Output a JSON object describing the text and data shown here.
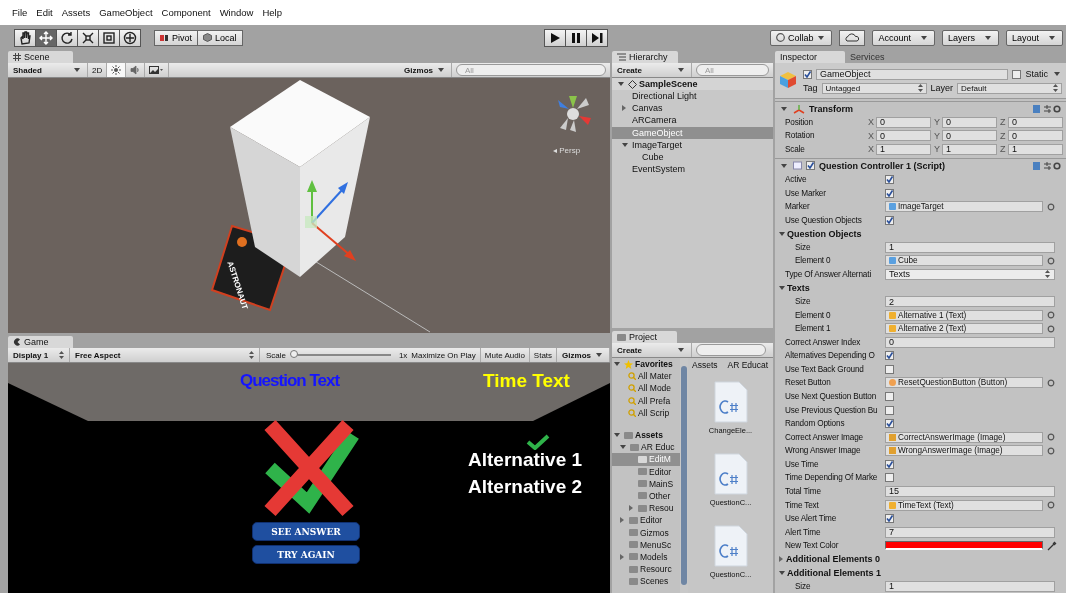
{
  "menu": [
    "File",
    "Edit",
    "Assets",
    "GameObject",
    "Component",
    "Window",
    "Help"
  ],
  "toolbar": {
    "tools": [
      {
        "kind": "hand",
        "selected": false
      },
      {
        "kind": "move",
        "selected": true
      },
      {
        "kind": "rotate",
        "selected": false
      },
      {
        "kind": "scale",
        "selected": false
      },
      {
        "kind": "rect",
        "selected": false
      },
      {
        "kind": "transform",
        "selected": false
      }
    ],
    "pivot": "Pivot",
    "local": "Local",
    "right": [
      {
        "kind": "collab",
        "label": "Collab"
      },
      {
        "kind": "cloud"
      },
      {
        "kind": "dropdown",
        "label": "Account"
      },
      {
        "kind": "dropdown",
        "label": "Layers"
      },
      {
        "kind": "dropdown",
        "label": "Layout"
      }
    ]
  },
  "scene": {
    "tab": "Scene",
    "shading": "Shaded",
    "mode_2d": "2D",
    "toggles": [
      {
        "kind": "lighting",
        "on": true
      },
      {
        "kind": "audio",
        "on": false
      },
      {
        "kind": "effects",
        "on": false
      }
    ],
    "gizmos": "Gizmos",
    "search_placeholder": "All",
    "marker_text": "ASTRONAUT",
    "view_label": "◂ Persp"
  },
  "game": {
    "tab": "Game",
    "display": "Display 1",
    "aspect": "Free Aspect",
    "scale": {
      "label": "Scale",
      "level": 0,
      "value": "1x"
    },
    "options": [
      "Maximize On Play",
      "Mute Audio",
      "Stats"
    ],
    "gizmos": "Gizmos",
    "question_text": "Question Text",
    "time_text": "Time Text",
    "alternatives": [
      {
        "label": "Alternative 1",
        "correct": true
      },
      {
        "label": "Alternative 2",
        "correct": false
      }
    ],
    "buttons": [
      "SEE ANSWER",
      "TRY AGAIN"
    ]
  },
  "hierarchy": {
    "tab": "Hierarchy",
    "create": "Create",
    "search_placeholder": "All",
    "scene": "SampleScene",
    "items": [
      {
        "label": "Directional Light",
        "selected": false
      },
      {
        "label": "Canvas",
        "selected": false,
        "expanded": false
      },
      {
        "label": "ARCamera",
        "selected": false
      },
      {
        "label": "GameObject",
        "selected": true
      },
      {
        "label": "ImageTarget",
        "selected": false,
        "expanded": true,
        "children": [
          {
            "label": "Cube",
            "selected": false
          }
        ]
      },
      {
        "label": "EventSystem",
        "selected": false
      }
    ]
  },
  "project": {
    "tab": "Project",
    "create": "Create",
    "favorites": {
      "label": "Favorites",
      "expanded": true,
      "items": [
        "All Mater",
        "All Mode",
        "All Prefa",
        "All Scrip"
      ]
    },
    "assets": {
      "label": "Assets",
      "expanded": true,
      "children": [
        {
          "label": "AR Educ",
          "selected": false,
          "expanded": true,
          "children": [
            {
              "label": "EditM",
              "selected": true
            },
            {
              "label": "Editor",
              "selected": false
            },
            {
              "label": "MainS",
              "selected": false
            },
            {
              "label": "Other",
              "selected": false
            },
            {
              "label": "Resou",
              "selected": false,
              "expanded": false
            }
          ]
        },
        {
          "label": "Editor",
          "selected": false,
          "expanded": false
        },
        {
          "label": "Gizmos",
          "selected": false
        },
        {
          "label": "MenuSc",
          "selected": false
        },
        {
          "label": "Models",
          "selected": false,
          "expanded": false
        },
        {
          "label": "Resourc",
          "selected": false
        },
        {
          "label": "Scenes",
          "selected": false
        }
      ]
    },
    "breadcrumb": [
      "Assets",
      "AR Educat"
    ],
    "files": [
      "ChangeEle...",
      "QuestionC...",
      "QuestionC..."
    ]
  },
  "inspector": {
    "tabs": [
      {
        "label": "Inspector",
        "selected": true
      },
      {
        "label": "Services",
        "selected": false
      }
    ],
    "object": {
      "active": true,
      "name": "GameObject",
      "static_label": "Static",
      "static": false,
      "tag_label": "Tag",
      "tag": "Untagged",
      "layer_label": "Layer",
      "layer": "Default"
    },
    "transform": {
      "title": "Transform",
      "expanded": true,
      "rows": [
        {
          "label": "Position",
          "values": [
            {
              "axis": "X",
              "value": "0"
            },
            {
              "axis": "Y",
              "value": "0"
            },
            {
              "axis": "Z",
              "value": "0"
            }
          ]
        },
        {
          "label": "Rotation",
          "values": [
            {
              "axis": "X",
              "value": "0"
            },
            {
              "axis": "Y",
              "value": "0"
            },
            {
              "axis": "Z",
              "value": "0"
            }
          ]
        },
        {
          "label": "Scale",
          "values": [
            {
              "axis": "X",
              "value": "1"
            },
            {
              "axis": "Y",
              "value": "1"
            },
            {
              "axis": "Z",
              "value": "1"
            }
          ]
        }
      ]
    },
    "script": {
      "title": "Question Controller 1 (Script)",
      "enabled": true,
      "expanded": true,
      "fields": [
        {
          "kind": "check",
          "label": "Active",
          "checked": true
        },
        {
          "kind": "check",
          "label": "Use Marker",
          "checked": true
        },
        {
          "kind": "gameobject",
          "label": "Marker",
          "value": "ImageTarget"
        },
        {
          "kind": "check",
          "label": "Use Question Objects",
          "checked": true
        },
        {
          "kind": "foldout",
          "label": "Question Objects",
          "expanded": true,
          "children": [
            {
              "kind": "number",
              "label": "Size",
              "value": "1"
            },
            {
              "kind": "gameobject",
              "label": "Element 0",
              "value": "Cube"
            }
          ]
        },
        {
          "kind": "enum",
          "label": "Type Of Answer Alternati",
          "value": "Texts"
        },
        {
          "kind": "foldout",
          "label": "Texts",
          "expanded": true,
          "children": [
            {
              "kind": "number",
              "label": "Size",
              "value": "2"
            },
            {
              "kind": "textref",
              "label": "Element 0",
              "value": "Alternative 1 (Text)"
            },
            {
              "kind": "textref",
              "label": "Element 1",
              "value": "Alternative 2 (Text)"
            }
          ]
        },
        {
          "kind": "number",
          "label": "Correct Answer Index",
          "value": "0"
        },
        {
          "kind": "check",
          "label": "Alternatives Depending O",
          "checked": true
        },
        {
          "kind": "check",
          "label": "Use Text Back Ground",
          "checked": false
        },
        {
          "kind": "buttonref",
          "label": "Reset Button",
          "value": "ResetQuestionButton (Button)"
        },
        {
          "kind": "check",
          "label": "Use Next Question Button",
          "checked": false
        },
        {
          "kind": "check",
          "label": "Use Previous Question Bu",
          "checked": false
        },
        {
          "kind": "check",
          "label": "Random Options",
          "checked": true
        },
        {
          "kind": "imageref",
          "label": "Correct Answer Image",
          "value": "CorrectAnswerImage (Image)"
        },
        {
          "kind": "imageref",
          "label": "Wrong Answer Image",
          "value": "WrongAnswerImage (Image)"
        },
        {
          "kind": "check",
          "label": "Use Time",
          "checked": true
        },
        {
          "kind": "check",
          "label": "Time Depending Of Marke",
          "checked": false
        },
        {
          "kind": "number",
          "label": "Total Time",
          "value": "15"
        },
        {
          "kind": "textref",
          "label": "Time Text",
          "value": "TimeText (Text)"
        },
        {
          "kind": "check",
          "label": "Use Alert Time",
          "checked": true
        },
        {
          "kind": "number",
          "label": "Alert Time",
          "value": "7"
        },
        {
          "kind": "color",
          "label": "New Text Color",
          "color": "#ff0000"
        },
        {
          "kind": "foldout",
          "label": "Additional Elements 0",
          "expanded": false
        },
        {
          "kind": "foldout",
          "label": "Additional Elements 1",
          "expanded": true,
          "children": [
            {
              "kind": "number",
              "label": "Size",
              "value": "1"
            }
          ]
        }
      ]
    }
  }
}
